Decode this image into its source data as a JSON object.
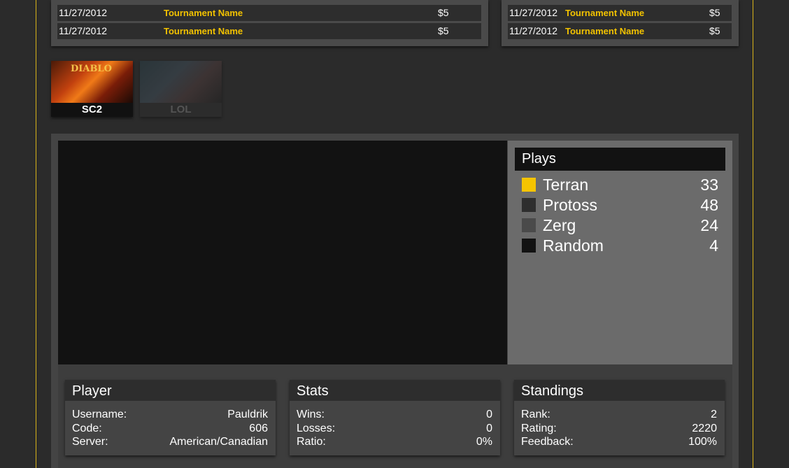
{
  "tournaments_left": [
    {
      "date": "11/27/2012",
      "name": "Tournament Name",
      "price": "$5"
    },
    {
      "date": "11/27/2012",
      "name": "Tournament Name",
      "price": "$5"
    }
  ],
  "tournaments_right": [
    {
      "date": "11/27/2012",
      "name": "Tournament Name",
      "price": "$5"
    },
    {
      "date": "11/27/2012",
      "name": "Tournament Name",
      "price": "$5"
    }
  ],
  "game_tabs": [
    {
      "label": "SC2",
      "logo_text": "DIABLO"
    },
    {
      "label": "LOL"
    }
  ],
  "plays": {
    "title": "Plays",
    "items": [
      {
        "name": "Terran",
        "value": "33",
        "color": "#f5c400"
      },
      {
        "name": "Protoss",
        "value": "48",
        "color": "#2e2e2e"
      },
      {
        "name": "Zerg",
        "value": "24",
        "color": "#4a4a4a"
      },
      {
        "name": "Random",
        "value": "4",
        "color": "#121212"
      }
    ]
  },
  "player": {
    "title": "Player",
    "rows": [
      {
        "k": "Username:",
        "v": "Pauldrik"
      },
      {
        "k": "Code:",
        "v": "606"
      },
      {
        "k": "Server:",
        "v": "American/Canadian"
      }
    ]
  },
  "stats": {
    "title": "Stats",
    "rows": [
      {
        "k": "Wins:",
        "v": "0"
      },
      {
        "k": "Losses:",
        "v": "0"
      },
      {
        "k": "Ratio:",
        "v": "0%"
      }
    ]
  },
  "standings": {
    "title": "Standings",
    "rows": [
      {
        "k": "Rank:",
        "v": "2"
      },
      {
        "k": "Rating:",
        "v": "2220"
      },
      {
        "k": "Feedback:",
        "v": "100%"
      }
    ]
  }
}
